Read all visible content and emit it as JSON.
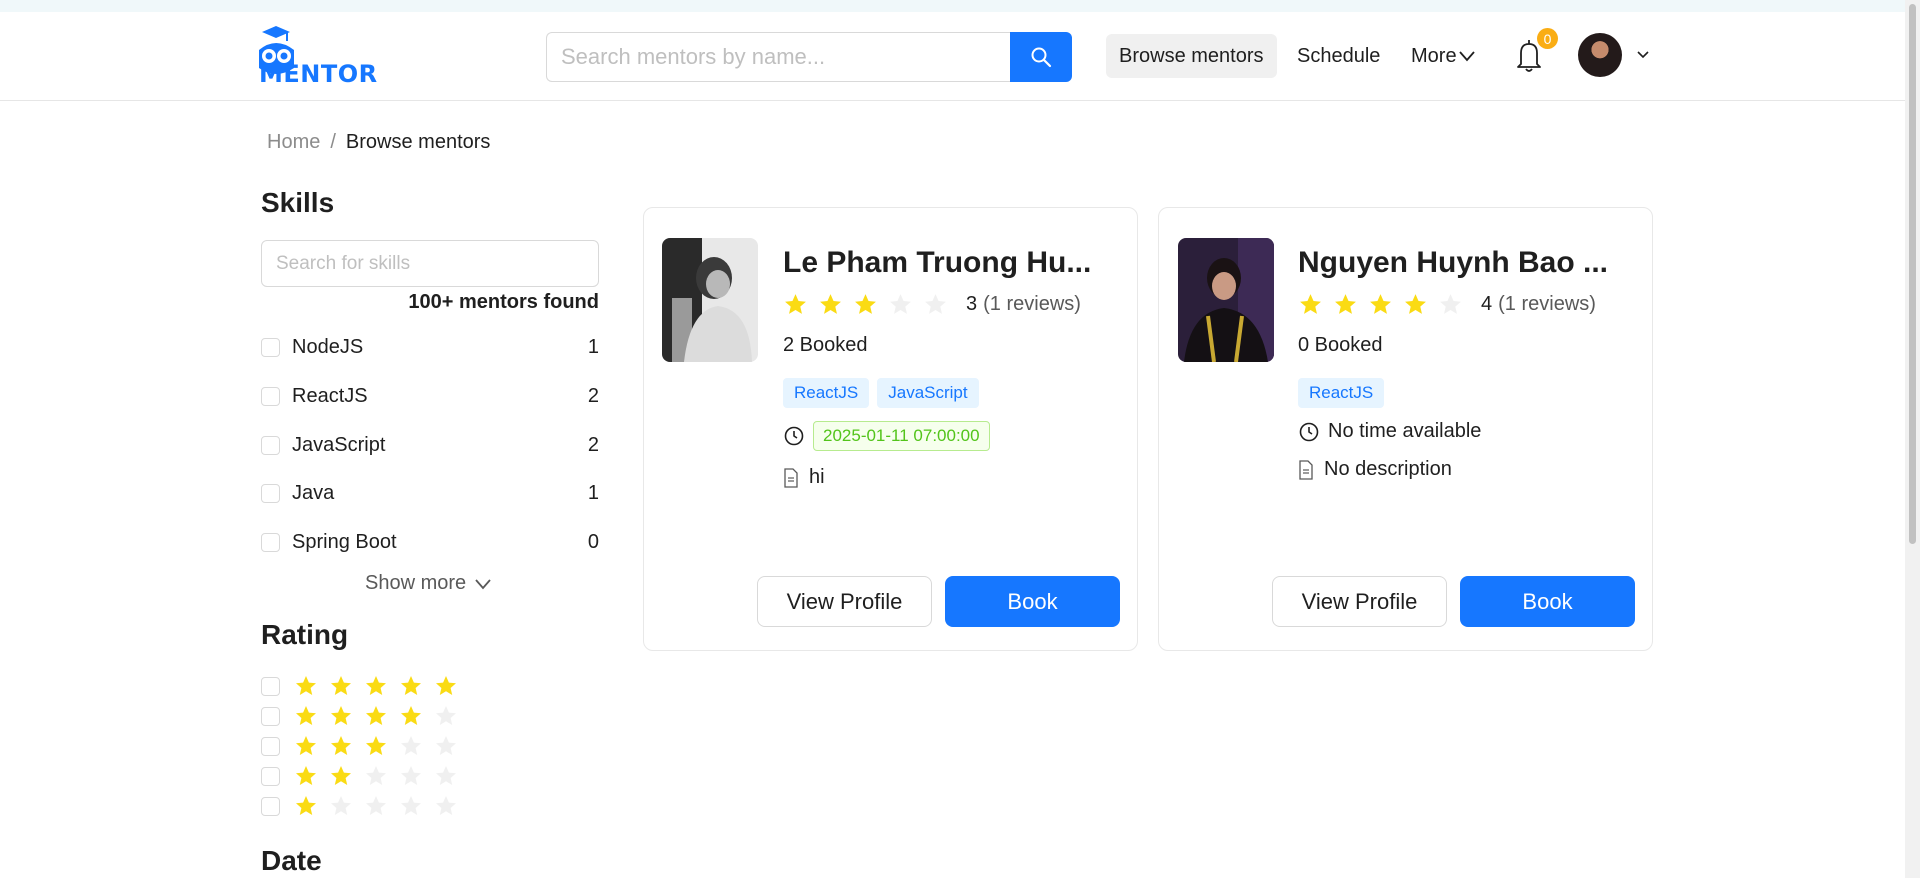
{
  "header": {
    "logo_text": "MENTOR",
    "search": {
      "placeholder": "Search mentors by name...",
      "value": ""
    },
    "nav": [
      {
        "label": "Browse mentors",
        "active": true
      },
      {
        "label": "Schedule"
      },
      {
        "label": "More"
      }
    ],
    "notifications": {
      "count": "0"
    }
  },
  "breadcrumb": {
    "home": "Home",
    "separator": "/",
    "current": "Browse mentors"
  },
  "filters": {
    "skills": {
      "title": "Skills",
      "search_placeholder": "Search for skills",
      "found_text": "100+ mentors found",
      "items": [
        {
          "label": "NodeJS",
          "count": "1"
        },
        {
          "label": "ReactJS",
          "count": "2"
        },
        {
          "label": "JavaScript",
          "count": "2"
        },
        {
          "label": "Java",
          "count": "1"
        },
        {
          "label": "Spring Boot",
          "count": "0"
        }
      ],
      "show_more": "Show more"
    },
    "rating": {
      "title": "Rating",
      "options": [
        5,
        4,
        3,
        2,
        1
      ]
    },
    "date": {
      "title": "Date"
    }
  },
  "mentors": [
    {
      "name": "Le Pham Truong Hu...",
      "rating": 3,
      "rating_value": "3",
      "reviews": "(1 reviews)",
      "booked": "2 Booked",
      "skills": [
        "ReactJS",
        "JavaScript"
      ],
      "time": "2025-01-11 07:00:00",
      "description": "hi",
      "view_label": "View Profile",
      "book_label": "Book"
    },
    {
      "name": "Nguyen Huynh Bao ...",
      "rating": 4,
      "rating_value": "4",
      "reviews": "(1 reviews)",
      "booked": "0 Booked",
      "skills": [
        "ReactJS"
      ],
      "time": "No time available",
      "description": "No description",
      "view_label": "View Profile",
      "book_label": "Book"
    }
  ],
  "colors": {
    "primary": "#1677ff",
    "star": "#fadb14",
    "star_empty": "#f0f0f0",
    "badge": "#faad14"
  }
}
